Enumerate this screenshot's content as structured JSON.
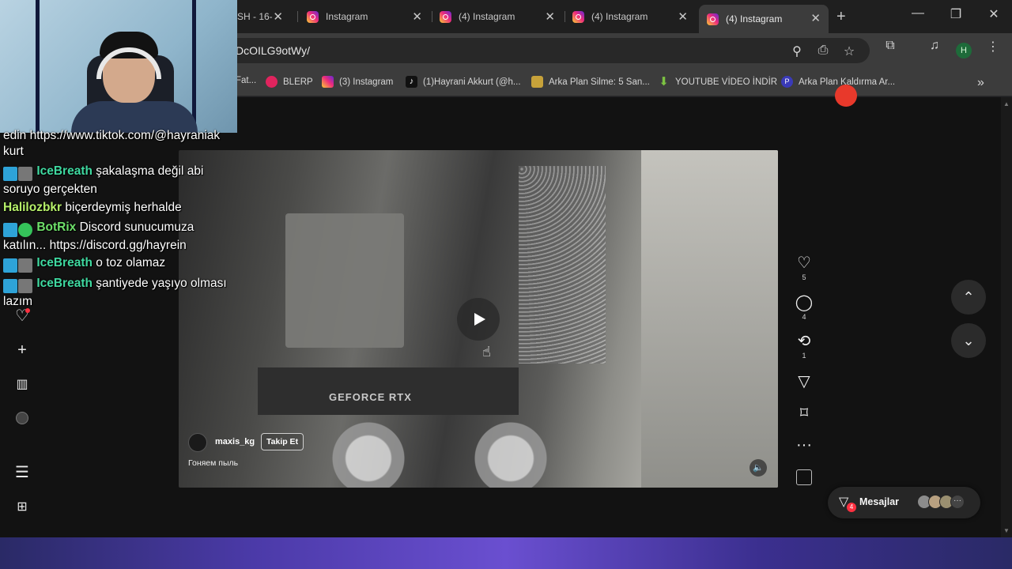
{
  "browser": {
    "tabs": [
      {
        "title": "SH - 16-",
        "active": false
      },
      {
        "title": "Instagram",
        "active": false
      },
      {
        "title": "(4) Instagram",
        "active": false
      },
      {
        "title": "(4) Instagram",
        "active": false
      },
      {
        "title": "(4) Instagram",
        "active": true
      }
    ],
    "new_tab_icon": "plus-icon",
    "url": "DcOILG9otWy/",
    "profile_initial": "H",
    "bookmarks": [
      {
        "label": "Fat...",
        "icon": "bookmark-icon",
        "color": "#888888"
      },
      {
        "label": "BLERP",
        "icon": "blerp-icon",
        "color": "#e0245e"
      },
      {
        "label": "(3) Instagram",
        "icon": "instagram-icon",
        "color": "#ee2a7b"
      },
      {
        "label": "(1)Hayrani Akkurt (@h...",
        "icon": "tiktok-icon",
        "color": "#111111"
      },
      {
        "label": "Arka Plan Silme: 5 San...",
        "icon": "layers-icon",
        "color": "#c7a23a"
      },
      {
        "label": "YOUTUBE VİDEO İNDİR",
        "icon": "download-icon",
        "color": "#7cc242"
      },
      {
        "label": "Arka Plan Kaldırma Ar...",
        "icon": "p-logo-icon",
        "color": "#3a3ab8"
      }
    ]
  },
  "chat": {
    "messages": [
      {
        "user": "",
        "text": "edin https://www.tiktok.com/@hayraniak kurt",
        "color": "#ffffff"
      },
      {
        "user": "IceBreath",
        "text": "şakalaşma değil abi soruyo gerçekten",
        "color": "#3fd9a0"
      },
      {
        "user": "Halilozbkr",
        "text": "biçerdeymiş herhalde",
        "color": "#b6f06a"
      },
      {
        "user": "BotRix",
        "text": "Discord sunucumuza katılın... https://discord.gg/hayrein",
        "color": "#6ee06a"
      },
      {
        "user": "IceBreath",
        "text": "o toz olamaz",
        "color": "#3fd9a0"
      },
      {
        "user": "IceBreath",
        "text": "şantiyede yaşıyo olması lazım",
        "color": "#3fd9a0"
      }
    ]
  },
  "instagram": {
    "post": {
      "owner": "maxis_kg",
      "follow_label": "Takip Et",
      "caption": "Гоняем пыль",
      "video_text": "GEFORCE RTX"
    },
    "actions": {
      "likes": "5",
      "comments": "4",
      "reposts": "1"
    },
    "messages_label": "Mesajlar",
    "messages_badge": "4"
  }
}
